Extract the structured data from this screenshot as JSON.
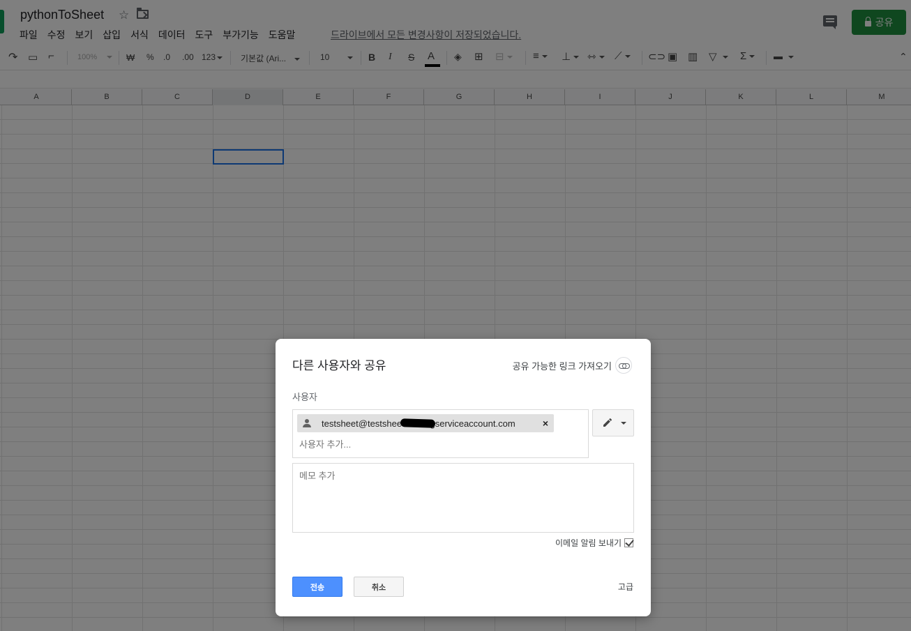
{
  "header": {
    "title": "pythonToSheet",
    "save_status": "드라이브에서 모든 변경사항이 저장되었습니다.",
    "share_label": "공유",
    "menu": [
      "파일",
      "수정",
      "보기",
      "삽입",
      "서식",
      "데이터",
      "도구",
      "부가기능",
      "도움말"
    ]
  },
  "toolbar": {
    "zoom": "100%",
    "currency": "₩",
    "percent": "%",
    "decrease_decimal": ".0",
    "increase_decimal": ".00",
    "more_formats": "123",
    "font": "기본값 (Ari...",
    "font_size": "10",
    "bold": "B",
    "italic": "I",
    "strike": "S",
    "text_color": "A",
    "sum": "Σ"
  },
  "grid": {
    "columns": [
      "A",
      "B",
      "C",
      "D",
      "E",
      "F",
      "G",
      "H",
      "I",
      "J",
      "K",
      "L",
      "M"
    ],
    "selected_column": "D"
  },
  "dialog": {
    "title": "다른 사용자와 공유",
    "get_link": "공유 가능한 링크 가져오기",
    "users_label": "사용자",
    "user_email": "testsheet@testsheet-          -iam.gserviceaccount.com",
    "remove_symbol": "×",
    "add_user_placeholder": "사용자 추가...",
    "note_placeholder": "메모 추가",
    "email_notify_label": "이메일 알림 보내기",
    "email_notify_checked": true,
    "send_label": "전송",
    "cancel_label": "취소",
    "advanced_label": "고급"
  },
  "colors": {
    "share_button": "#1e8e3e",
    "send_button": "#4d90fe",
    "active_cell": "#1a73e8",
    "overlay": "rgba(0,0,0,0.5)"
  }
}
